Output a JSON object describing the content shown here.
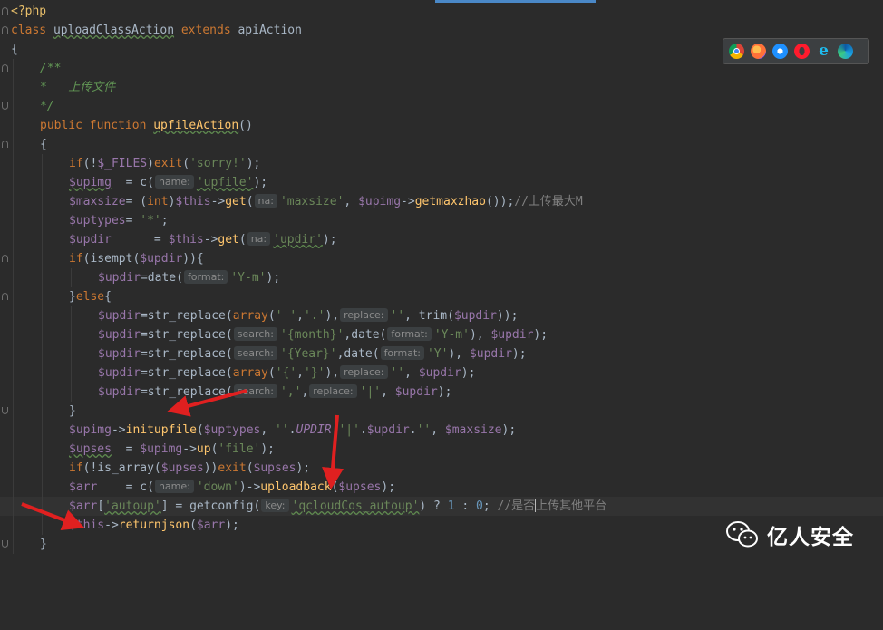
{
  "editor": {
    "lines": {
      "l1": "<?php",
      "l2a": "class ",
      "l2b": "uploadClassAction",
      "l2c": " extends ",
      "l2d": "apiAction",
      "l3": "{",
      "l4": "/**",
      "l5": "*   上传文件",
      "l6": "*/",
      "l7a": "public function ",
      "l7b": "upfileAction",
      "l7c": "()",
      "l8": "{",
      "l9a": "if",
      "l9b": "(!",
      "l9c": "$_FILES",
      "l9d": ")",
      "l9e": "exit",
      "l9f": "(",
      "l9g": "'sorry!'",
      "l9h": ");",
      "l10a": "$upimg",
      "l10b": "  = c(",
      "l10h": "name:",
      "l10c": "'upfile'",
      "l10d": ");",
      "l11a": "$maxsize",
      "l11b": "= (",
      "l11c": "int",
      "l11d": ")",
      "l11e": "$this",
      "l11f": "->",
      "l11g": "get",
      "l11h": "(",
      "l11hint": "na:",
      "l11i": "'maxsize'",
      "l11j": ", ",
      "l11k": "$upimg",
      "l11l": "->",
      "l11m": "getmaxzhao",
      "l11n": "());",
      "l11o": "//上传最大M",
      "l12a": "$uptypes",
      "l12b": "= ",
      "l12c": "'*'",
      "l12d": ";",
      "l13a": "$updir",
      "l13b": "      = ",
      "l13c": "$this",
      "l13d": "->",
      "l13e": "get",
      "l13f": "(",
      "l13hint": "na:",
      "l13g": "'updir'",
      "l13h": ");",
      "l14a": "if",
      "l14b": "(isempt(",
      "l14c": "$updir",
      "l14d": ")){",
      "l15a": "$updir",
      "l15b": "=date(",
      "l15hint": "format:",
      "l15c": "'Y-m'",
      "l15d": ");",
      "l16a": "}",
      "l16b": "else",
      "l16c": "{",
      "l17a": "$updir",
      "l17b": "=str_replace(",
      "l17c": "array",
      "l17d": "(",
      "l17e": "' '",
      "l17f": ",",
      "l17g": "'.'",
      "l17h": "),",
      "l17hint": "replace:",
      "l17i": "''",
      "l17j": ", trim(",
      "l17k": "$updir",
      "l17l": "));",
      "l18a": "$updir",
      "l18b": "=str_replace(",
      "l18hint": "search:",
      "l18c": "'{month}'",
      "l18d": ",date(",
      "l18hint2": "format:",
      "l18e": "'Y-m'",
      "l18f": "), ",
      "l18g": "$updir",
      "l18h": ");",
      "l19a": "$updir",
      "l19b": "=str_replace(",
      "l19hint": "search:",
      "l19c": "'{Year}'",
      "l19d": ",date(",
      "l19hint2": "format:",
      "l19e": "'Y'",
      "l19f": "), ",
      "l19g": "$updir",
      "l19h": ");",
      "l20a": "$updir",
      "l20b": "=str_replace(",
      "l20c": "array",
      "l20d": "(",
      "l20e": "'{'",
      "l20f": ",",
      "l20g": "'}'",
      "l20h": "),",
      "l20hint": "replace:",
      "l20i": "''",
      "l20j": ", ",
      "l20k": "$updir",
      "l20l": ");",
      "l21a": "$updir",
      "l21b": "=str_replace(",
      "l21hint": "search:",
      "l21c": "','",
      "l21d": ",",
      "l21hint2": "replace:",
      "l21e": "'|'",
      "l21f": ", ",
      "l21g": "$updir",
      "l21h": ");",
      "l22": "}",
      "l23a": "$upimg",
      "l23b": "->",
      "l23c": "initupfile",
      "l23d": "(",
      "l23e": "$uptypes",
      "l23f": ", ",
      "l23g": "''",
      "l23h": ".",
      "l23i": "UPDIR",
      "l23j": ".",
      "l23k": "'|'",
      "l23l": ".",
      "l23m": "$updir",
      "l23n": ".",
      "l23o": "''",
      "l23p": ", ",
      "l23q": "$maxsize",
      "l23r": ");",
      "l24a": "$upses",
      "l24b": "  = ",
      "l24c": "$upimg",
      "l24d": "->",
      "l24e": "up",
      "l24f": "(",
      "l24g": "'file'",
      "l24h": ");",
      "l25a": "if",
      "l25b": "(!is_array(",
      "l25c": "$upses",
      "l25d": "))",
      "l25e": "exit",
      "l25f": "(",
      "l25g": "$upses",
      "l25h": ");",
      "l26a": "$arr",
      "l26b": "    = c(",
      "l26hint": "name:",
      "l26c": "'down'",
      "l26d": ")->",
      "l26e": "uploadback",
      "l26f": "(",
      "l26g": "$upses",
      "l26h": ");",
      "l27a": "$arr",
      "l27b": "[",
      "l27c": "'autoup'",
      "l27d": "] = getconfig(",
      "l27hint": "key:",
      "l27e": "'qcloudCos_autoup'",
      "l27f": ") ? ",
      "l27g": "1",
      "l27h": " : ",
      "l27i": "0",
      "l27j": "; ",
      "l27k": "//是否",
      "l27l": "上传其他平台",
      "l28a": "$this",
      "l28b": "->",
      "l28c": "returnjson",
      "l28d": "(",
      "l28e": "$arr",
      "l28f": ");",
      "l29": "}"
    }
  },
  "browser_toolbar": {
    "icons": [
      "chrome-icon",
      "firefox-icon",
      "safari-icon",
      "opera-icon",
      "ie-icon",
      "edge-icon"
    ]
  },
  "watermark": {
    "text": "亿人安全",
    "icon": "wechat-icon"
  },
  "colors": {
    "background": "#2b2b2b",
    "keyword": "#cc7832",
    "string": "#6a8759",
    "variable": "#9876aa",
    "function": "#ffc66d",
    "arrow": "#e02020"
  }
}
